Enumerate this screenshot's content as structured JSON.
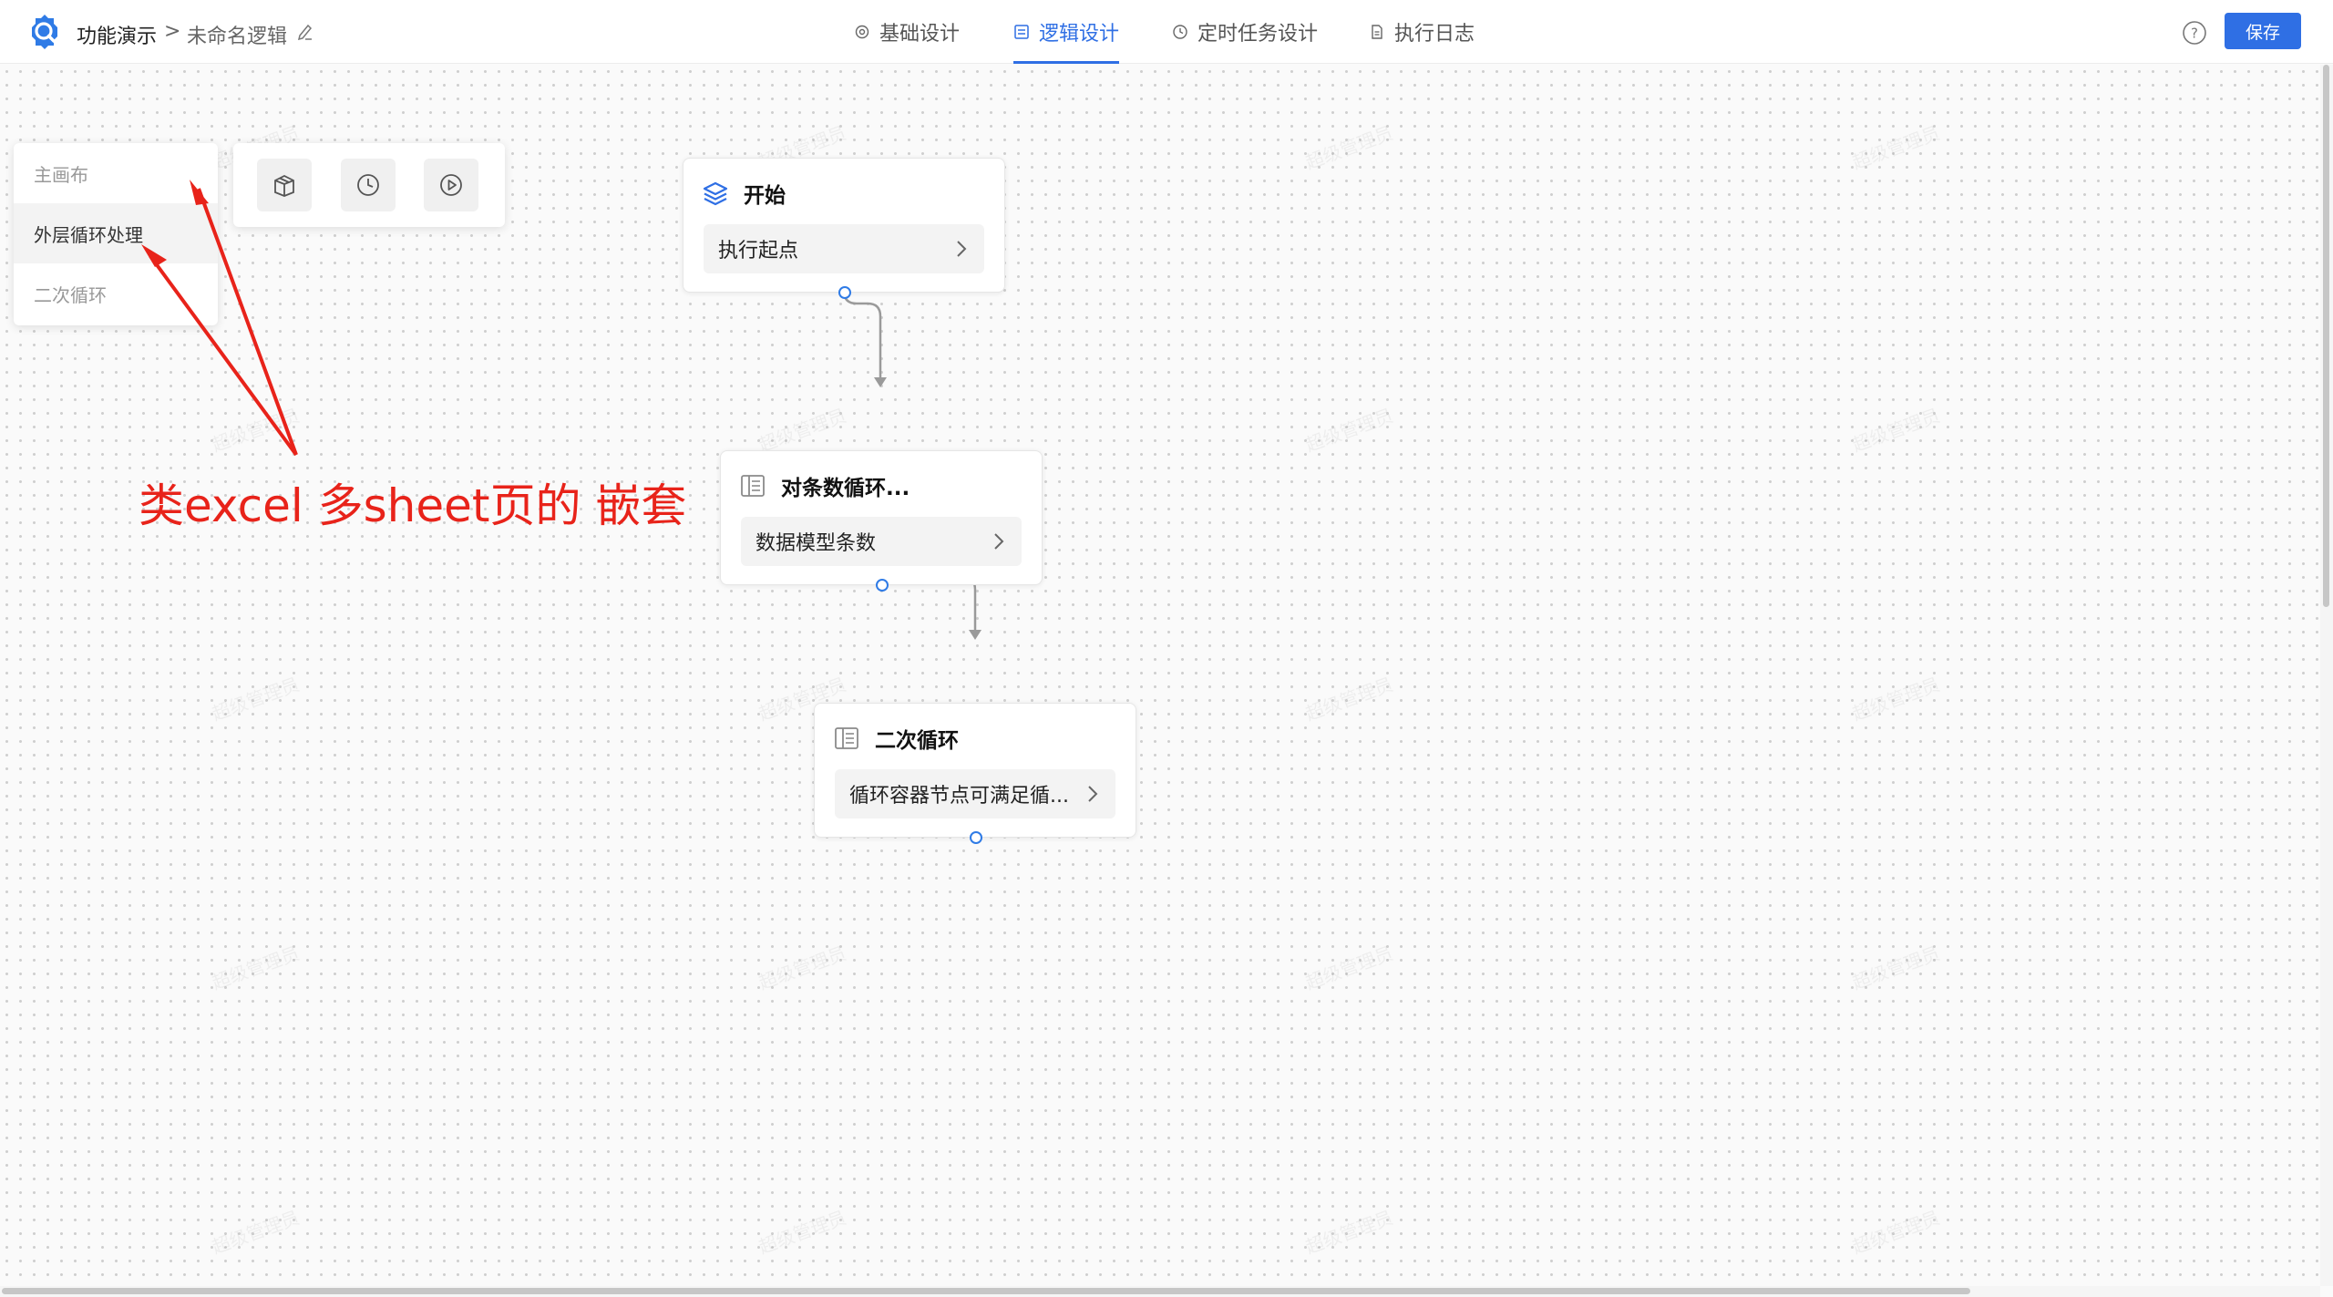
{
  "header": {
    "app_name": "功能演示",
    "separator": ">",
    "doc_name": "未命名逻辑",
    "tabs": [
      {
        "label": "基础设计",
        "icon": "gear-icon",
        "active": false
      },
      {
        "label": "逻辑设计",
        "icon": "layout-icon",
        "active": true
      },
      {
        "label": "定时任务设计",
        "icon": "clock-icon",
        "active": false
      },
      {
        "label": "执行日志",
        "icon": "document-icon",
        "active": false
      }
    ],
    "save_label": "保存",
    "accent_color": "#2f6fe4"
  },
  "sheet_panel": {
    "items": [
      {
        "label": "主画布",
        "active": false
      },
      {
        "label": "外层循环处理",
        "active": true
      },
      {
        "label": "二次循环",
        "active": false
      }
    ]
  },
  "tool_panel": {
    "buttons": [
      "package-icon",
      "clock-icon",
      "play-icon"
    ]
  },
  "nodes": [
    {
      "title": "开始",
      "icon": "layers-icon",
      "body": "执行起点"
    },
    {
      "title": "对条数循环...",
      "icon": "table-icon",
      "body": "数据模型条数"
    },
    {
      "title": "二次循环",
      "icon": "table-icon",
      "body": "循环容器节点可满足循..."
    }
  ],
  "annotation": {
    "text": "类excel 多sheet页的 嵌套",
    "color": "#e8231a"
  },
  "watermark_text": "超级管理员"
}
